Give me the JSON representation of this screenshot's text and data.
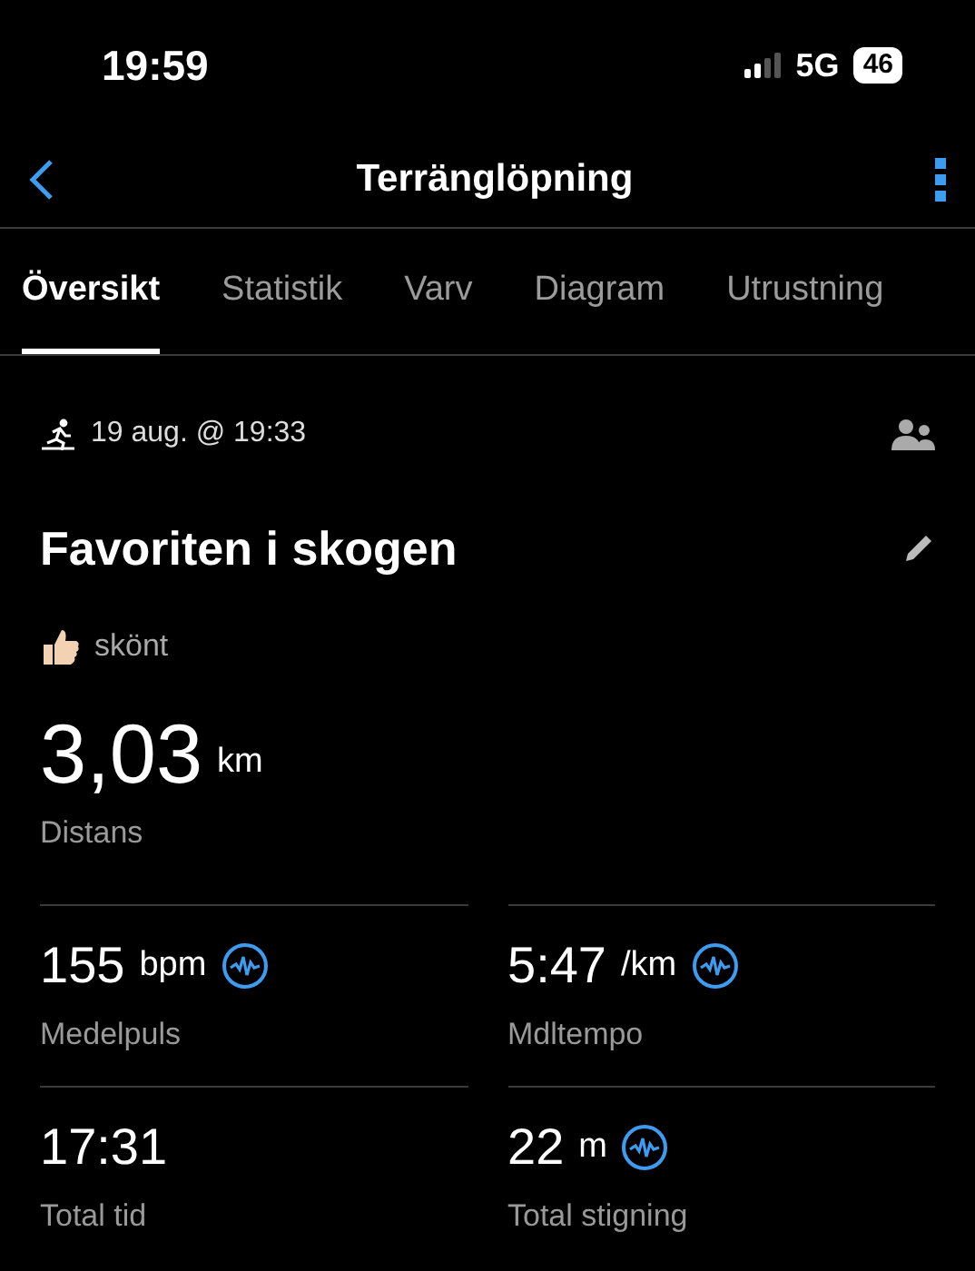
{
  "status_bar": {
    "time": "19:59",
    "network": "5G",
    "battery": "46"
  },
  "header": {
    "title": "Terränglöpning"
  },
  "tabs": [
    {
      "label": "Översikt",
      "selected": true
    },
    {
      "label": "Statistik",
      "selected": false
    },
    {
      "label": "Varv",
      "selected": false
    },
    {
      "label": "Diagram",
      "selected": false
    },
    {
      "label": "Utrustning",
      "selected": false
    }
  ],
  "activity": {
    "date": "19 aug. @ 19:33",
    "name": "Favoriten i skogen",
    "feeling": "skönt"
  },
  "distance": {
    "value": "3,03",
    "unit": "km",
    "label": "Distans"
  },
  "stats": [
    {
      "value": "155",
      "unit": "bpm",
      "label": "Medelpuls",
      "has_chart": true
    },
    {
      "value": "5:47",
      "unit": "/km",
      "label": "Mdltempo",
      "has_chart": true
    },
    {
      "value": "17:31",
      "label": "Total tid",
      "has_chart": false
    },
    {
      "value": "22",
      "unit": "m",
      "label": "Total stigning",
      "has_chart": true
    }
  ]
}
